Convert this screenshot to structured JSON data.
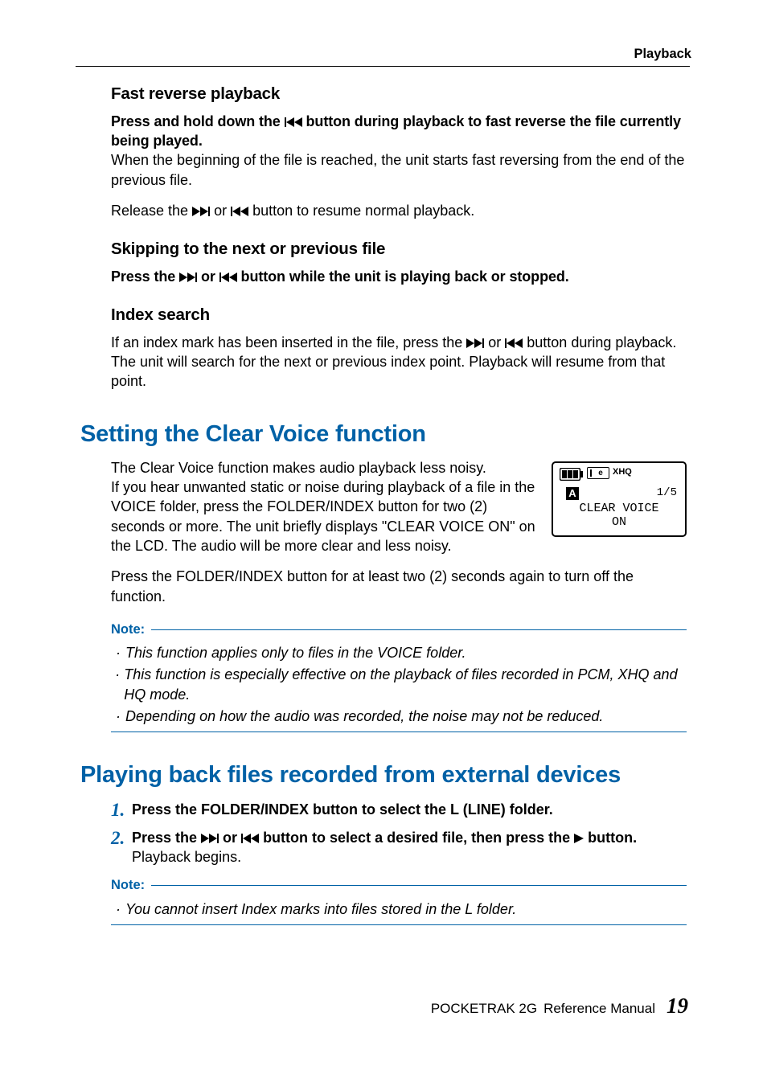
{
  "header": {
    "section": "Playback"
  },
  "fast_reverse": {
    "title": "Fast reverse playback",
    "bold1_a": "Press and hold down the ",
    "bold1_b": " button during playback to fast reverse the file currently being played.",
    "para2": "When the beginning of the file is reached, the unit starts fast reversing from the end of the previous file.",
    "para3_a": "Release the ",
    "para3_mid": " or ",
    "para3_b": " button to resume normal playback."
  },
  "skipping": {
    "title": "Skipping to the next or previous file",
    "bold_a": "Press the ",
    "bold_mid": " or ",
    "bold_b": " button while the unit is playing back or stopped."
  },
  "index": {
    "title": "Index search",
    "p1_a": "If an index mark has been inserted in the file, press the ",
    "p1_mid": " or ",
    "p1_b": " button during playback.",
    "p2": "The unit will search for the next or previous index point. Playback will resume from that point."
  },
  "clear_voice": {
    "title": "Setting the Clear Voice function",
    "p1a": "The Clear Voice function makes audio playback less noisy.",
    "p1b": "If you hear unwanted static or noise during playback of a file in the VOICE folder, press the FOLDER/INDEX button for two (2) seconds or more. The unit briefly displays \"CLEAR VOICE ON\" on the LCD. The audio will be more clear and less noisy.",
    "p2": "Press the FOLDER/INDEX button for at least two (2) seconds again to turn off the function.",
    "lcd": {
      "sd_label": "e",
      "mode": "XHQ",
      "folder": "A",
      "count": "1/5",
      "line1": "CLEAR VOICE",
      "line2": "ON"
    }
  },
  "notes1": {
    "label": "Note:",
    "items": [
      "This function applies only to files in the VOICE folder.",
      "This function is especially effective on the playback of files recorded in PCM, XHQ and HQ mode.",
      "Depending on how the audio was recorded, the noise may not be reduced."
    ]
  },
  "external": {
    "title": "Playing back files recorded from external devices",
    "step1": "Press the FOLDER/INDEX button to select the L (LINE) folder.",
    "step2_a": "Press the ",
    "step2_mid": " or ",
    "step2_b": " button to select a desired file, then press the ",
    "step2_c": " button.",
    "step2_sub": "Playback begins."
  },
  "notes2": {
    "label": "Note:",
    "items": [
      "You cannot insert Index marks into files stored in the L folder."
    ]
  },
  "footer": {
    "product": "POCKETRAK 2G",
    "doc": "Reference Manual",
    "page": "19"
  }
}
